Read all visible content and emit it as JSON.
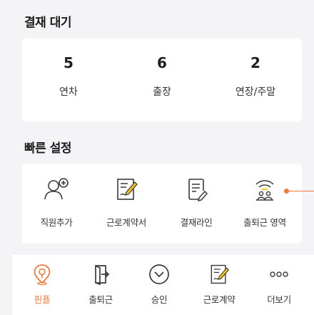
{
  "approval": {
    "title": "결재 대기",
    "stats": [
      {
        "value": "5",
        "label": "연차"
      },
      {
        "value": "6",
        "label": "출장"
      },
      {
        "value": "2",
        "label": "연장/주말"
      }
    ]
  },
  "quick_settings": {
    "title": "빠른 설정",
    "items": [
      {
        "label": "직원추가",
        "icon": "add-user-icon"
      },
      {
        "label": "근로계약서",
        "icon": "contract-icon"
      },
      {
        "label": "결재라인",
        "icon": "document-edit-icon"
      },
      {
        "label": "출퇴근 영역",
        "icon": "wifi-people-icon"
      }
    ]
  },
  "bottom_nav": {
    "items": [
      {
        "label": "핀플",
        "icon": "location-pin-icon",
        "active": true
      },
      {
        "label": "출퇴근",
        "icon": "door-exit-icon"
      },
      {
        "label": "승인",
        "icon": "chevron-circle-icon"
      },
      {
        "label": "근로계약",
        "icon": "contract-icon"
      },
      {
        "label": "더보기",
        "icon": "more-dots-icon"
      }
    ]
  },
  "colors": {
    "accent": "#f07a3c",
    "background": "#f4f4f6",
    "card": "#ffffff",
    "icon_yellow": "#f5c21b",
    "icon_dark": "#3a3a3a"
  }
}
